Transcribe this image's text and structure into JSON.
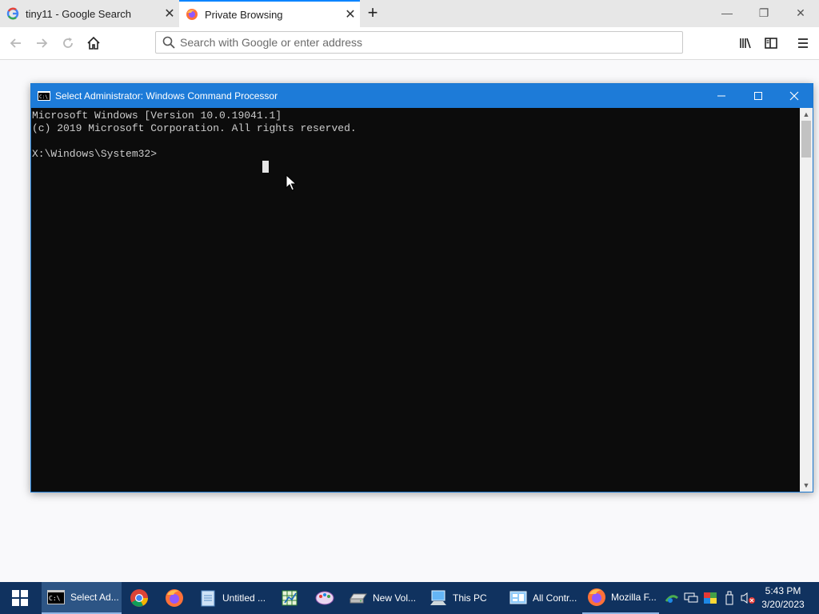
{
  "browser": {
    "tabs": [
      {
        "title": "tiny11 - Google Search",
        "icon": "google-icon"
      },
      {
        "title": "Private Browsing",
        "icon": "firefox-private-icon",
        "active": true
      }
    ],
    "address_placeholder": "Search with Google or enter address",
    "accent": "#0a84ff"
  },
  "cmd": {
    "title": "Select Administrator: Windows Command Processor",
    "lines": [
      "Microsoft Windows [Version 10.0.19041.1]",
      "(c) 2019 Microsoft Corporation. All rights reserved.",
      "",
      "X:\\Windows\\System32>"
    ],
    "titlebar_color": "#1d7bd8"
  },
  "taskbar": {
    "items": [
      {
        "label": "Select Ad...",
        "icon": "cmd-icon"
      },
      {
        "label": "",
        "icon": "chrome-icon"
      },
      {
        "label": "",
        "icon": "firefox-icon"
      },
      {
        "label": "Untitled ...",
        "icon": "notepad-icon"
      },
      {
        "label": "",
        "icon": "spreadsheet-icon"
      },
      {
        "label": "",
        "icon": "paint-icon"
      },
      {
        "label": "New Vol...",
        "icon": "drive-icon"
      },
      {
        "label": "This PC",
        "icon": "computer-icon"
      },
      {
        "label": "All Contr...",
        "icon": "control-panel-icon"
      },
      {
        "label": "Mozilla F...",
        "icon": "firefox-icon"
      }
    ],
    "clock": {
      "time": "5:43 PM",
      "date": "3/20/2023"
    },
    "color": "#10325f"
  }
}
